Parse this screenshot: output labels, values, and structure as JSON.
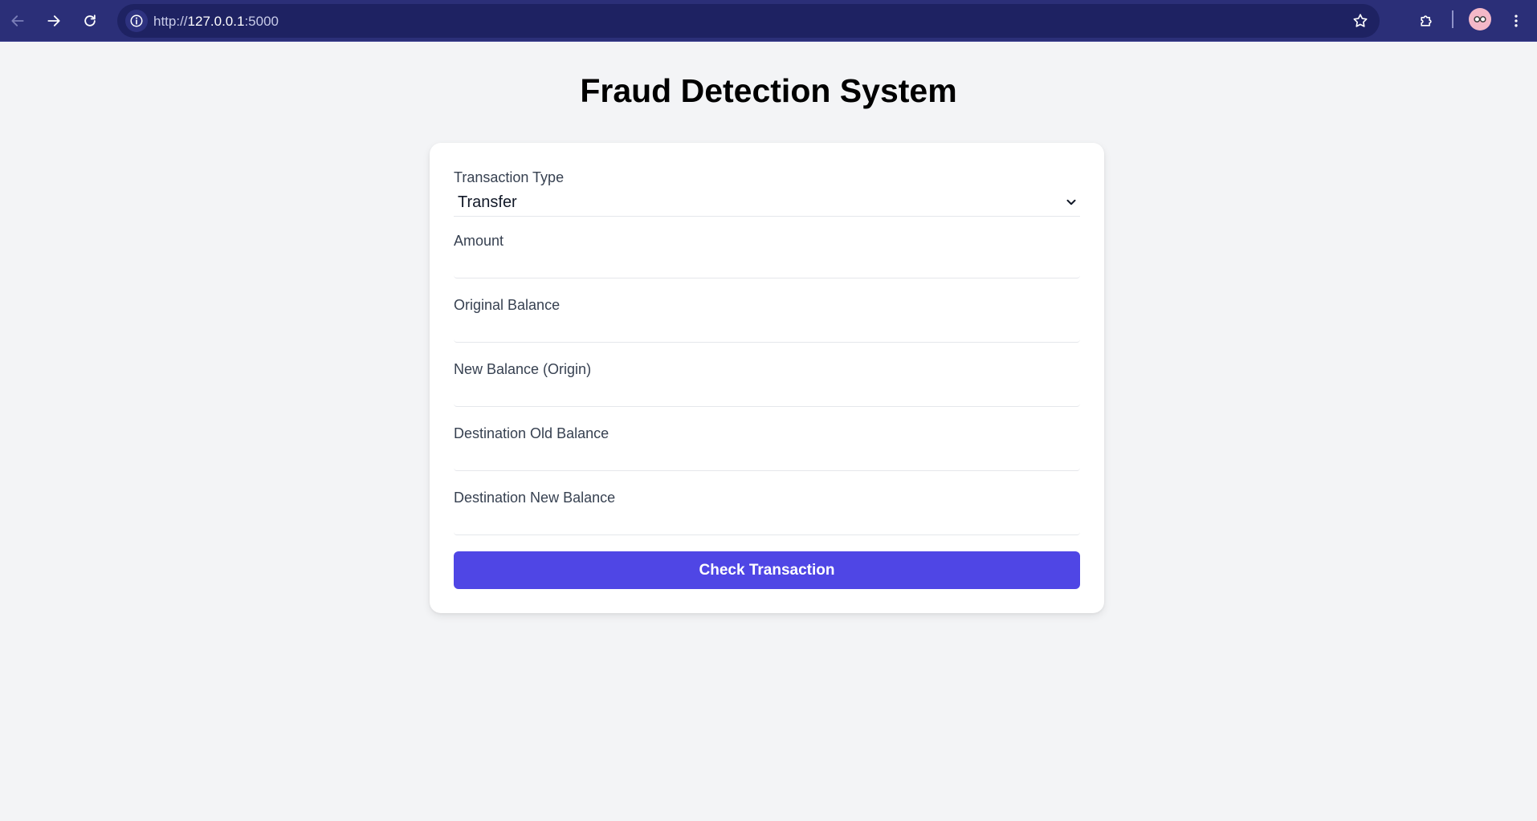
{
  "browser": {
    "url_scheme": "http://",
    "url_host": "127.0.0.1",
    "url_port": ":5000"
  },
  "page": {
    "title": "Fraud Detection System"
  },
  "form": {
    "transaction_type": {
      "label": "Transaction Type",
      "selected": "Transfer"
    },
    "amount": {
      "label": "Amount",
      "value": ""
    },
    "original_balance": {
      "label": "Original Balance",
      "value": ""
    },
    "new_balance_origin": {
      "label": "New Balance (Origin)",
      "value": ""
    },
    "dest_old_balance": {
      "label": "Destination Old Balance",
      "value": ""
    },
    "dest_new_balance": {
      "label": "Destination New Balance",
      "value": ""
    },
    "submit_label": "Check Transaction"
  },
  "colors": {
    "browser_bar": "#2b2f78",
    "page_bg": "#f3f4f6",
    "button_accent": "#4f46e5"
  },
  "icons": {
    "back": "arrow-left-icon",
    "forward": "arrow-right-icon",
    "reload": "reload-icon",
    "site_info": "info-icon",
    "bookmark": "star-icon",
    "extensions": "puzzle-icon",
    "profile": "avatar-icon",
    "menu": "kebab-menu-icon",
    "select": "chevron-down-icon"
  }
}
